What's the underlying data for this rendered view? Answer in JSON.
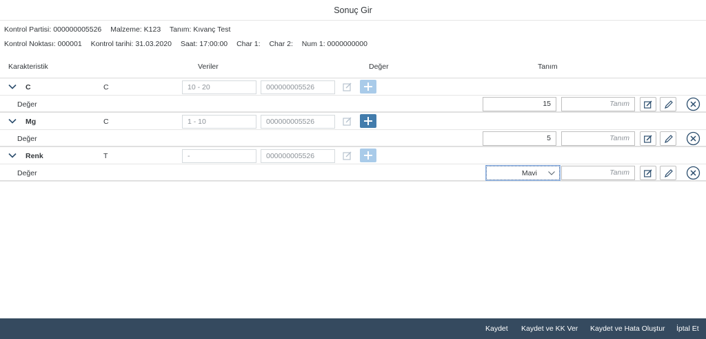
{
  "header": {
    "title": "Sonuç Gir"
  },
  "info": {
    "line1": [
      "Kontrol Partisi: 000000005526",
      "Malzeme: K123",
      "Tanım: Kıvanç Test"
    ],
    "line2": [
      "Kontrol Noktası: 000001",
      "Kontrol tarihi: 31.03.2020",
      "Saat: 17:00:00",
      "Char 1:",
      "Char 2:",
      "Num 1: 0000000000"
    ]
  },
  "columns": {
    "karakteristik": "Karakteristik",
    "veriler": "Veriler",
    "deger": "Değer",
    "tanim": "Tanım"
  },
  "characteristics": [
    {
      "name": "C",
      "type": "C",
      "range": "10 - 20",
      "lot": "000000005526",
      "add_active": false,
      "value_label": "Değer",
      "value": "15",
      "tanim_placeholder": "Tanım"
    },
    {
      "name": "Mg",
      "type": "C",
      "range": "1 - 10",
      "lot": "000000005526",
      "add_active": true,
      "value_label": "Değer",
      "value": "5",
      "tanim_placeholder": "Tanım"
    },
    {
      "name": "Renk",
      "type": "T",
      "range": "-",
      "lot": "000000005526",
      "add_active": false,
      "value_label": "Değer",
      "value": "Mavi",
      "tanim_placeholder": "Tanım"
    }
  ],
  "footer": {
    "kaydet": "Kaydet",
    "kaydet_kk": "Kaydet ve KK Ver",
    "kaydet_hata": "Kaydet ve Hata Oluştur",
    "iptal": "İptal Et"
  },
  "colors": {
    "footer_bg": "#354a5f",
    "accent": "#427cac",
    "accent_disabled": "#a9cbe9",
    "dark_icon": "#2b4d6d"
  },
  "icons": [
    "chevron-down-icon",
    "edit-icon",
    "add-icon",
    "pencil-icon",
    "close-circle-icon",
    "dropdown-arrow-icon"
  ]
}
